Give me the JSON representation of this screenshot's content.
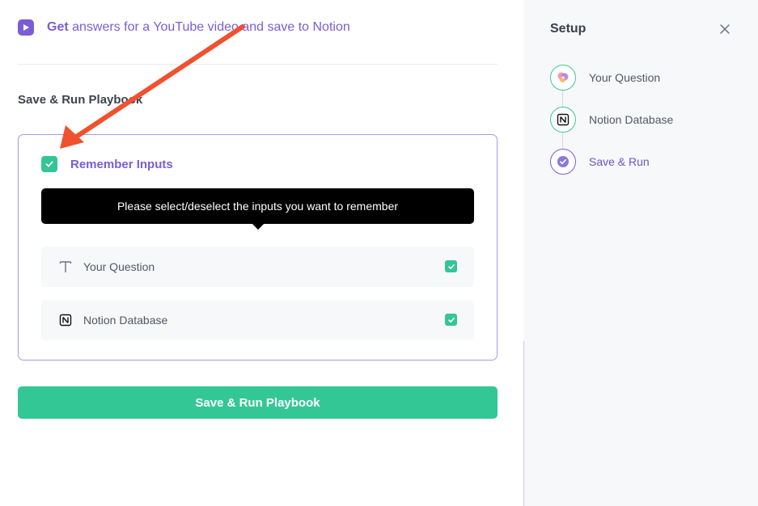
{
  "header": {
    "bold": "Get",
    "text": " answers for a YouTube video and save to Notion",
    "icon": "play-icon"
  },
  "section_title": "Save & Run Playbook",
  "remember": {
    "label": "Remember Inputs",
    "checked": true
  },
  "tooltip": "Please select/deselect the inputs you want to remember",
  "inputs": [
    {
      "label": "Your Question",
      "icon": "text-type-icon",
      "checked": true
    },
    {
      "label": "Notion Database",
      "icon": "notion-icon",
      "checked": true
    }
  ],
  "run_button": "Save & Run Playbook",
  "side": {
    "title": "Setup",
    "close_icon": "close-icon",
    "steps": [
      {
        "label": "Your Question",
        "icon": "ai-orb-icon",
        "state": "done"
      },
      {
        "label": "Notion Database",
        "icon": "notion-icon",
        "state": "done"
      },
      {
        "label": "Save & Run",
        "icon": "check-circle-icon",
        "state": "active"
      }
    ]
  },
  "colors": {
    "accent": "#7c5cd6",
    "success": "#34c796",
    "annotation_arrow": "#f0512f"
  }
}
